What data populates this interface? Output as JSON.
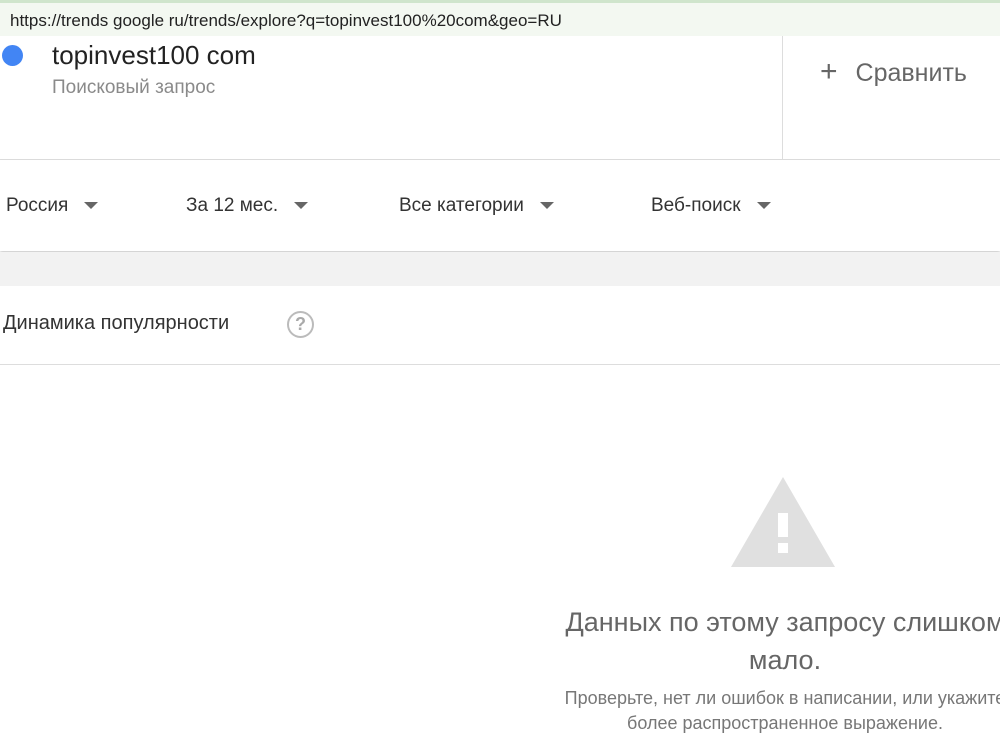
{
  "browser": {
    "url": "https://trends google ru/trends/explore?q=topinvest100%20com&geo=RU"
  },
  "term": {
    "name": "topinvest100 com",
    "type": "Поисковый запрос",
    "color": "#4285f4"
  },
  "compare": {
    "label": "Сравнить"
  },
  "filters": [
    {
      "label": "Россия"
    },
    {
      "label": "За 12 мес."
    },
    {
      "label": "Все категории"
    },
    {
      "label": "Веб-поиск"
    }
  ],
  "section": {
    "title": "Динамика популярности",
    "help": "?"
  },
  "empty": {
    "title": "Данных по этому запросу слишком мало.",
    "hint": "Проверьте, нет ли ошибок в написании, или укажите более распространенное выражение."
  }
}
